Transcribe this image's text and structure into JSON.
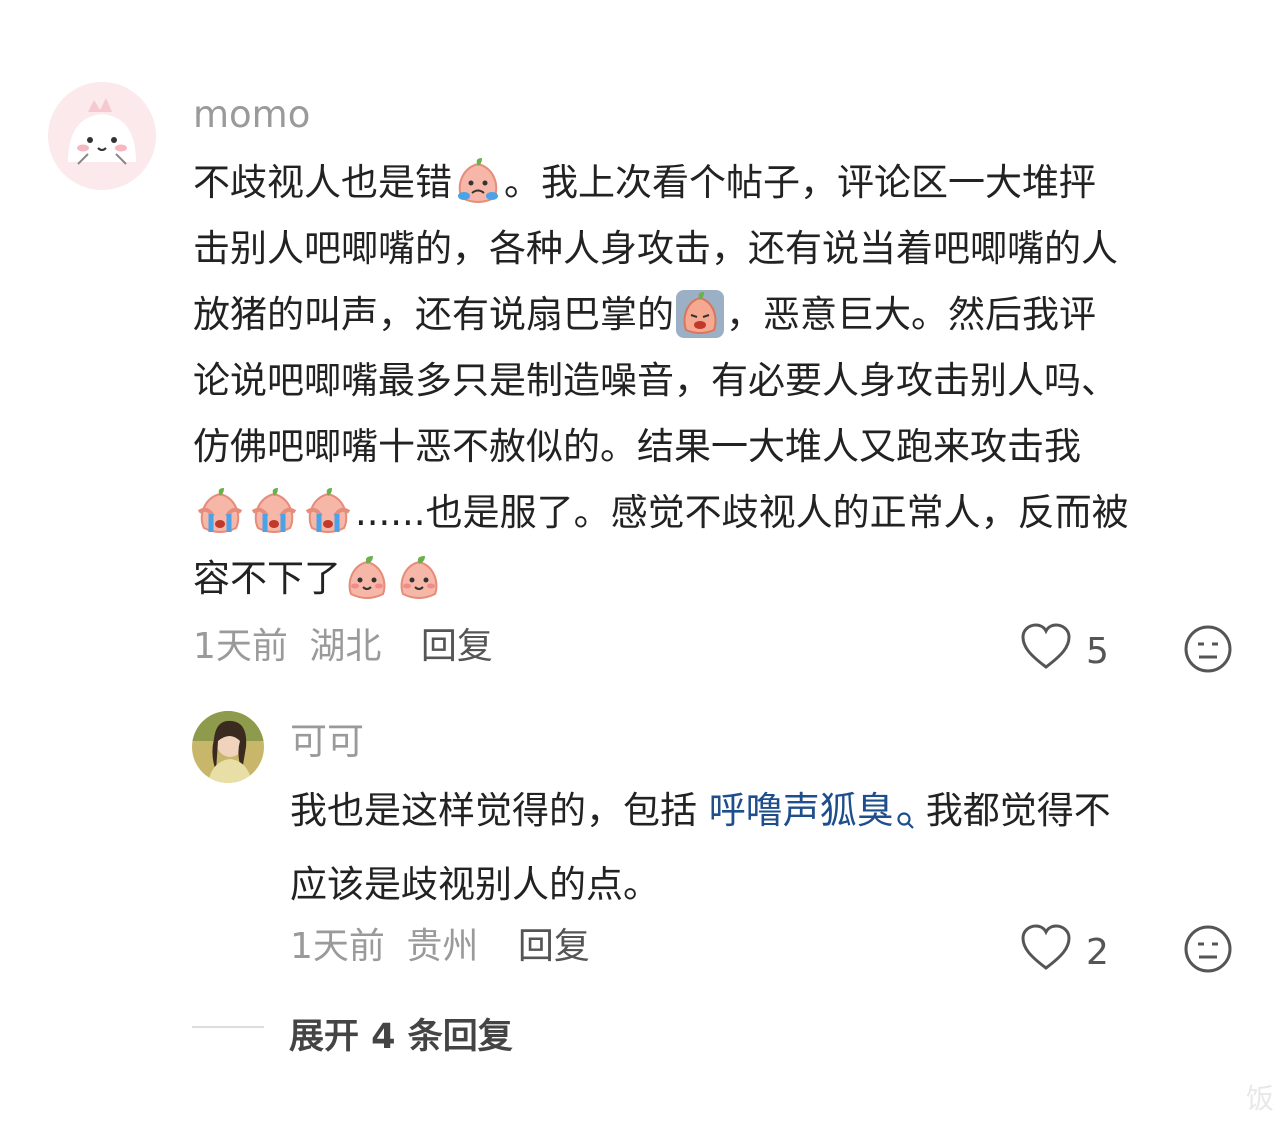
{
  "comment": {
    "username": "momo",
    "lines": [
      [
        "不歧视人也是错",
        "。我上次看个帖子，评论区一大堆抨"
      ],
      [
        "击别人吧唧嘴的，各种人身攻击，还有说当着吧唧嘴的人"
      ],
      [
        "放猪的叫声，还有说扇巴掌的",
        "，恶意巨大。然后我评"
      ],
      [
        "论说吧唧嘴最多只是制造噪音，有必要人身攻击别人吗、"
      ],
      [
        "仿佛吧唧嘴十恶不赦似的。结果一大堆人又跑来攻击我"
      ],
      [
        "",
        "......也是服了。感觉不歧视人的正常人，反而被"
      ],
      [
        "容不下了"
      ]
    ],
    "time": "1天前",
    "location": "湖北",
    "reply_label": "回复",
    "likes": "5"
  },
  "reply": {
    "username": "可可",
    "line1_before": "我也是这样觉得的，包括 ",
    "link": "呼噜声狐臭",
    "line1_after": "我都觉得不",
    "line2": "应该是歧视别人的点。",
    "time": "1天前",
    "location": "贵州",
    "reply_label": "回复",
    "likes": "2"
  },
  "expand_label": "展开 4 条回复",
  "watermark": "饭",
  "icons": {
    "like": "heart-outline-icon",
    "dislike": "meh-face-icon",
    "search": "search-mini-icon"
  },
  "colors": {
    "link": "#1f4e8c",
    "muted": "#9a9a9a",
    "text": "#222222"
  }
}
